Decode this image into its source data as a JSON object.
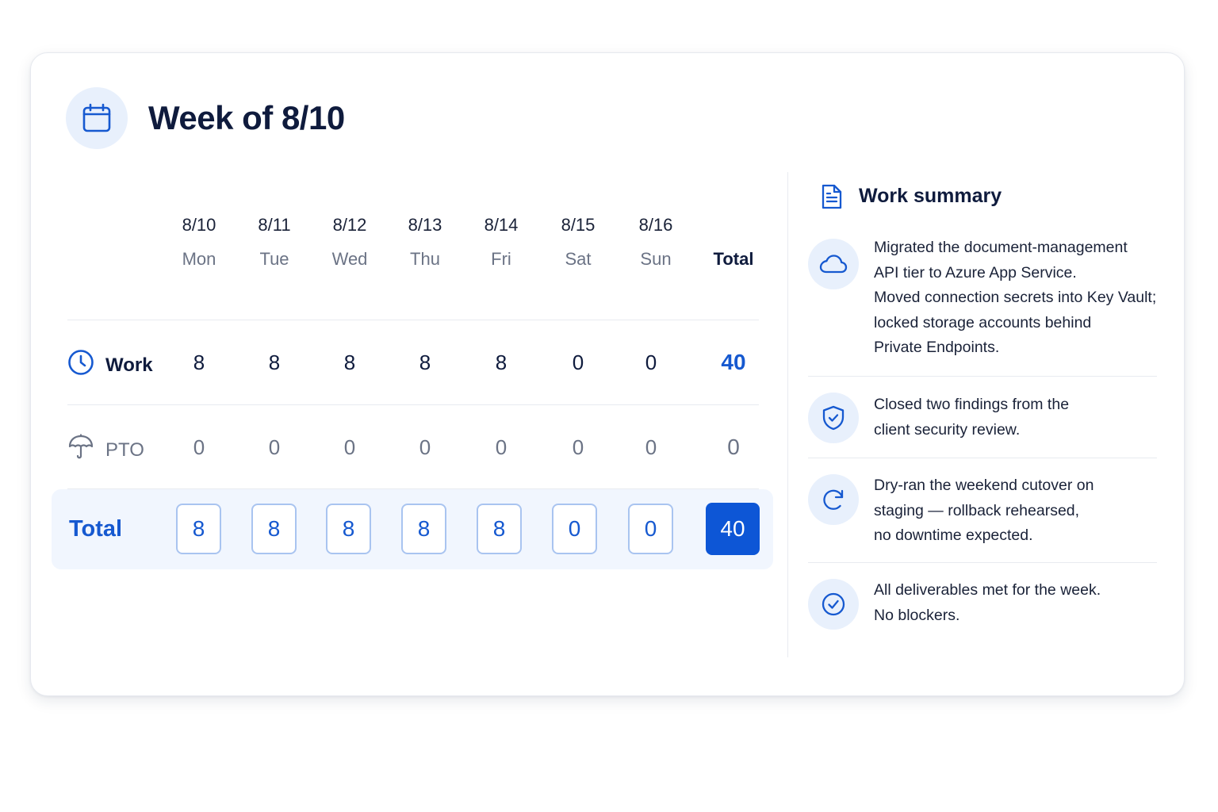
{
  "header": {
    "title": "Week of 8/10",
    "icon": "calendar-icon"
  },
  "timesheet": {
    "columns": [
      {
        "date": "8/10",
        "day": "Mon"
      },
      {
        "date": "8/11",
        "day": "Tue"
      },
      {
        "date": "8/12",
        "day": "Wed"
      },
      {
        "date": "8/13",
        "day": "Thu"
      },
      {
        "date": "8/14",
        "day": "Fri"
      },
      {
        "date": "8/15",
        "day": "Sat"
      },
      {
        "date": "8/16",
        "day": "Sun"
      }
    ],
    "total_header": "Total",
    "rows": {
      "work": {
        "label": "Work",
        "icon": "clock-icon",
        "values": [
          "8",
          "8",
          "8",
          "8",
          "8",
          "0",
          "0"
        ],
        "total": "40"
      },
      "pto": {
        "label": "PTO",
        "icon": "umbrella-icon",
        "values": [
          "0",
          "0",
          "0",
          "0",
          "0",
          "0",
          "0"
        ],
        "total": "0"
      }
    },
    "totals": {
      "label": "Total",
      "values": [
        "8",
        "8",
        "8",
        "8",
        "8",
        "0",
        "0"
      ],
      "grand_total": "40"
    }
  },
  "summary": {
    "title": "Work summary",
    "icon": "document-icon",
    "items": [
      {
        "icon": "cloud-icon",
        "lines": [
          "Migrated the document-management",
          "API tier to Azure App Service.",
          "Moved connection secrets into Key Vault;",
          "locked storage accounts behind",
          "Private Endpoints."
        ]
      },
      {
        "icon": "shield-check-icon",
        "lines": [
          "Closed two findings from the",
          "client security review."
        ]
      },
      {
        "icon": "refresh-icon",
        "lines": [
          "Dry-ran the weekend cutover on",
          "staging — rollback rehearsed,",
          "no downtime expected."
        ]
      },
      {
        "icon": "check-circle-icon",
        "lines": [
          "All deliverables met for the week.",
          "No blockers."
        ]
      }
    ]
  },
  "colors": {
    "accent": "#0d56d6",
    "accent_text": "#1659d0",
    "icon_bg": "#e8f0fc",
    "band_bg": "#f1f6fe",
    "muted": "#6b7385"
  }
}
